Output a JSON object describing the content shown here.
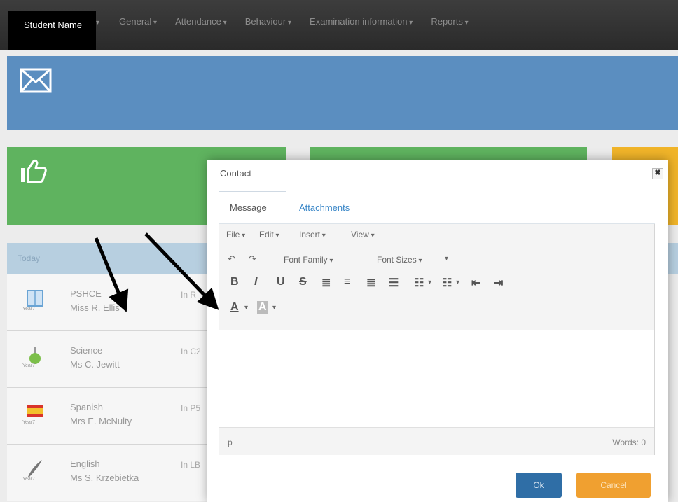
{
  "topnav": {
    "student_name": "Student Name",
    "menu": [
      "General",
      "Attendance",
      "Behaviour",
      "Examination information",
      "Reports"
    ]
  },
  "today_label": "Today",
  "lessons": [
    {
      "subject": "PSHCE",
      "teacher": "Miss R. Ellis",
      "room": "In R",
      "icon": "book-icon",
      "caption": "Year7"
    },
    {
      "subject": "Science",
      "teacher": "Ms C. Jewitt",
      "room": "In C2",
      "icon": "flask-icon",
      "caption": "Year7"
    },
    {
      "subject": "Spanish",
      "teacher": "Mrs E. McNulty",
      "room": "In P5",
      "icon": "flag-icon",
      "caption": "Year7"
    },
    {
      "subject": "English",
      "teacher": "Ms S. Krzebietka",
      "room": "In LB",
      "icon": "quill-icon",
      "caption": "Year7"
    }
  ],
  "dialog": {
    "title": "Contact",
    "close": "✖",
    "tabs": {
      "message": "Message",
      "attachments": "Attachments"
    },
    "editor": {
      "menu": [
        "File",
        "Edit",
        "Insert",
        "View"
      ],
      "font_family": "Font Family",
      "font_sizes": "Font Sizes",
      "bold": "B",
      "italic": "I",
      "underline": "U",
      "strike": "S",
      "text_color": "A",
      "bg_color": "A",
      "path": "p",
      "words": "Words: 0"
    },
    "ok": "Ok",
    "cancel": "Cancel"
  },
  "colors": {
    "blue_banner": "#5b8ec0",
    "green_card": "#5fb35f",
    "yellow_card": "#f0b429",
    "ok_button": "#2f6ea6",
    "cancel_button": "#f0a030",
    "link": "#3a87c8"
  }
}
